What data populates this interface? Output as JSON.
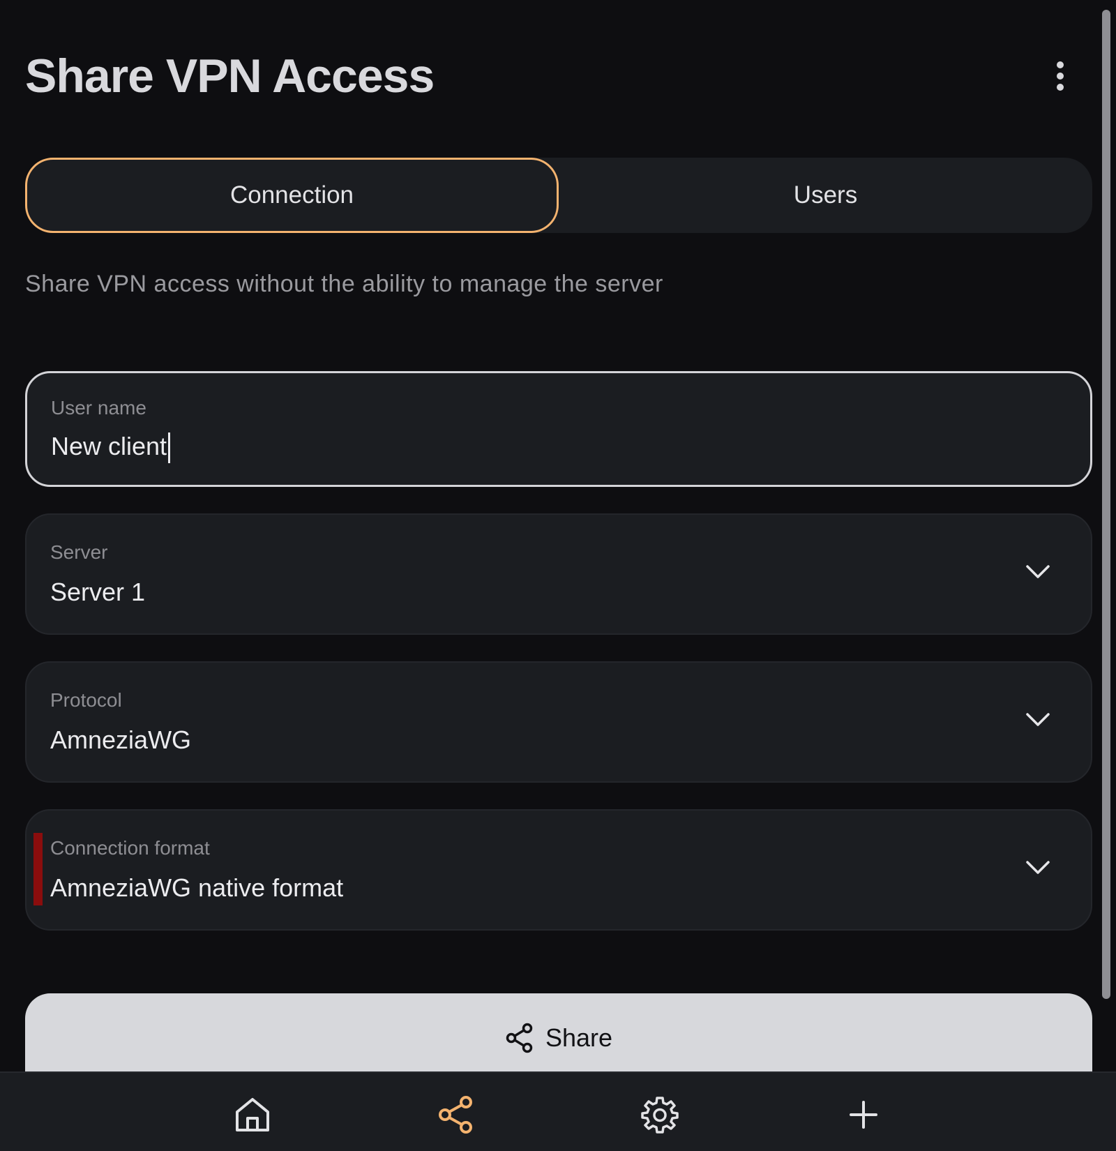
{
  "header": {
    "title": "Share VPN Access",
    "more_icon": "more-vertical-icon"
  },
  "tabs": [
    {
      "label": "Connection",
      "active": true
    },
    {
      "label": "Users",
      "active": false
    }
  ],
  "description": "Share VPN access without the ability to manage the server",
  "form": {
    "user_name": {
      "label": "User name",
      "value": "New client"
    },
    "server": {
      "label": "Server",
      "value": "Server 1"
    },
    "protocol": {
      "label": "Protocol",
      "value": "AmneziaWG"
    },
    "connection_format": {
      "label": "Connection format",
      "value": "AmneziaWG native format"
    }
  },
  "share_button": {
    "label": "Share",
    "icon": "share-icon"
  },
  "bottom_nav": [
    {
      "name": "home",
      "icon": "home-icon"
    },
    {
      "name": "share",
      "icon": "share-icon",
      "active": true
    },
    {
      "name": "settings",
      "icon": "gear-icon"
    },
    {
      "name": "add",
      "icon": "plus-icon"
    }
  ],
  "colors": {
    "background": "#0e0e11",
    "surface": "#1b1d21",
    "accent": "#f4b36f",
    "error": "#8a0d0d",
    "button": "#d7d8dc"
  }
}
